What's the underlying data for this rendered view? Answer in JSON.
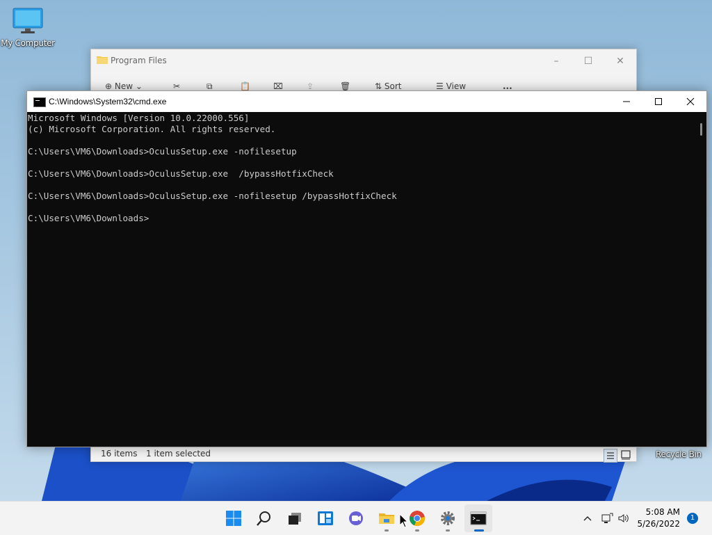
{
  "desktop": {
    "icons": [
      {
        "label": "My Computer",
        "icon": "monitor-icon"
      },
      {
        "label": "Recycle Bin",
        "icon": "recycle-bin-icon"
      }
    ]
  },
  "explorer": {
    "title": "Program Files",
    "toolbar": {
      "new_label": "New",
      "sort_label": "Sort",
      "view_label": "View",
      "more_label": "..."
    },
    "status": {
      "item_count": "16 items",
      "selection": "1 item selected"
    }
  },
  "cmd": {
    "title": "C:\\Windows\\System32\\cmd.exe",
    "lines": [
      "Microsoft Windows [Version 10.0.22000.556]",
      "(c) Microsoft Corporation. All rights reserved.",
      "",
      "C:\\Users\\VM6\\Downloads>OculusSetup.exe -nofilesetup",
      "",
      "C:\\Users\\VM6\\Downloads>OculusSetup.exe  /bypassHotfixCheck",
      "",
      "C:\\Users\\VM6\\Downloads>OculusSetup.exe -nofilesetup /bypassHotfixCheck",
      "",
      "C:\\Users\\VM6\\Downloads>"
    ]
  },
  "taskbar": {
    "apps": [
      "start-icon",
      "search-icon",
      "task-view-icon",
      "widgets-icon",
      "chat-icon",
      "file-explorer-icon",
      "chrome-icon",
      "settings-icon",
      "terminal-icon"
    ],
    "clock": {
      "time": "5:08 AM",
      "date": "5/26/2022"
    },
    "notification_count": "1"
  },
  "colors": {
    "console_bg": "#0c0c0c",
    "console_fg": "#cccccc",
    "accent": "#0067c0"
  }
}
